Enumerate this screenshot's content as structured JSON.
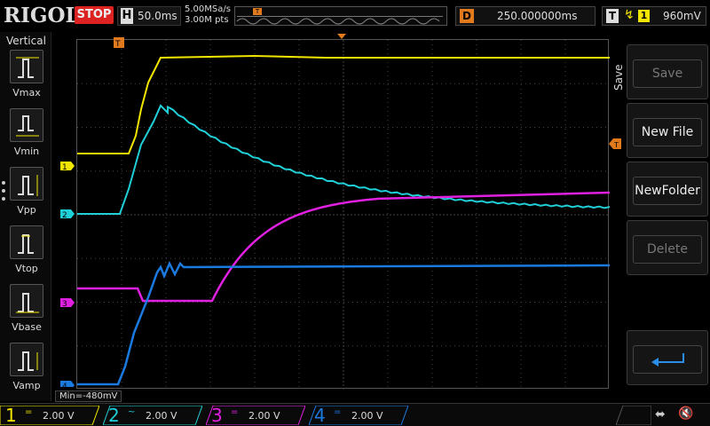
{
  "topbar": {
    "brand": "RIGOL",
    "run_state": "STOP",
    "horizontal_label": "H",
    "timebase": "50.0ms",
    "sample_rate": "5.00MSa/s",
    "memory_depth": "3.00M pts",
    "delay_label": "D",
    "delay_value": "250.000000ms",
    "trigger_label": "T",
    "trigger_channel": "1",
    "trigger_level": "960mV"
  },
  "left_menu": {
    "title": "Vertical",
    "items": [
      {
        "label": "Vmax",
        "icon": "vmax-icon"
      },
      {
        "label": "Vmin",
        "icon": "vmin-icon"
      },
      {
        "label": "Vpp",
        "icon": "vpp-icon"
      },
      {
        "label": "Vtop",
        "icon": "vtop-icon"
      },
      {
        "label": "Vbase",
        "icon": "vbase-icon"
      },
      {
        "label": "Vamp",
        "icon": "vamp-icon"
      }
    ]
  },
  "right_menu": {
    "title": "Save",
    "buttons": [
      {
        "label": "Save",
        "enabled": false
      },
      {
        "label": "New File",
        "enabled": true
      },
      {
        "label": "NewFolder",
        "enabled": true
      },
      {
        "label": "Delete",
        "enabled": false
      }
    ],
    "return_icon": "return-arrow-icon"
  },
  "measurement": {
    "readout": "Min=-480mV"
  },
  "channels": [
    {
      "number": "1",
      "coupling": "=",
      "scale": "2.00 V",
      "color": "#f2e600"
    },
    {
      "number": "2",
      "coupling": "~",
      "scale": "2.00 V",
      "color": "#1fd0d8"
    },
    {
      "number": "3",
      "coupling": "=",
      "scale": "2.00 V",
      "color": "#e020e0"
    },
    {
      "number": "4",
      "coupling": "=",
      "scale": "2.00 V",
      "color": "#1a7ae0"
    }
  ],
  "markers": {
    "ch1": "1",
    "ch2": "2",
    "ch3": "3",
    "ch4": "4",
    "trigger_time": "T",
    "trigger_level": "T"
  },
  "colors": {
    "accent_orange": "#e07a1c",
    "stop_red": "#d22222"
  }
}
